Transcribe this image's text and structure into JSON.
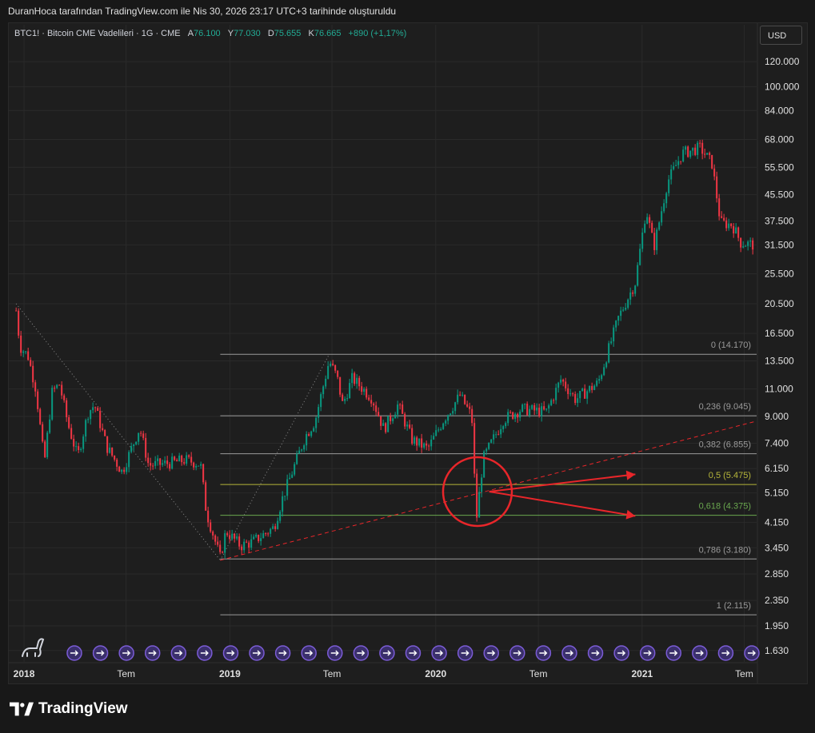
{
  "caption": "DuranHoca tarafından TradingView.com ile Nis 30, 2026 23:17 UTC+3 tarihinde oluşturuldu",
  "legend": {
    "symbol": "BTC1! · Bitcoin CME Vadelileri · 1G · CME",
    "open_label": "A",
    "open": "76.100",
    "high_label": "Y",
    "high": "77.030",
    "low_label": "D",
    "low": "75.655",
    "close_label": "K",
    "close": "76.665",
    "change": "+890 (+1,17%)"
  },
  "currency_button": "USD",
  "brand": "TradingView",
  "colors": {
    "up": "#089981",
    "down": "#f23645",
    "accent_red": "#e8262a",
    "fib_line": "#9a9a9a",
    "fib_05": "#b5b53a",
    "fib_0618": "#6aa84f",
    "grid": "#2a2a2a",
    "event_marker": "#7b5cd6"
  },
  "icons": [
    "dino-icon",
    "tradingview-logo-icon",
    "event-marker-icon"
  ],
  "chart_data": {
    "type": "candlestick",
    "title": "",
    "y_scale": "log",
    "ylim": [
      1500,
      135000
    ],
    "y_ticks": [
      {
        "value": 120000,
        "label": "120.000"
      },
      {
        "value": 100000,
        "label": "100.000"
      },
      {
        "value": 84000,
        "label": "84.000"
      },
      {
        "value": 68000,
        "label": "68.000"
      },
      {
        "value": 55500,
        "label": "55.500"
      },
      {
        "value": 45500,
        "label": "45.500"
      },
      {
        "value": 37500,
        "label": "37.500"
      },
      {
        "value": 31500,
        "label": "31.500"
      },
      {
        "value": 25500,
        "label": "25.500"
      },
      {
        "value": 20500,
        "label": "20.500"
      },
      {
        "value": 16500,
        "label": "16.500"
      },
      {
        "value": 13500,
        "label": "13.500"
      },
      {
        "value": 11000,
        "label": "11.000"
      },
      {
        "value": 9000,
        "label": "9.000"
      },
      {
        "value": 7400,
        "label": "7.400"
      },
      {
        "value": 6150,
        "label": "6.150"
      },
      {
        "value": 5150,
        "label": "5.150"
      },
      {
        "value": 4150,
        "label": "4.150"
      },
      {
        "value": 3450,
        "label": "3.450"
      },
      {
        "value": 2850,
        "label": "2.850"
      },
      {
        "value": 2350,
        "label": "2.350"
      },
      {
        "value": 1950,
        "label": "1.950"
      },
      {
        "value": 1630,
        "label": "1.630"
      }
    ],
    "x_ticks": [
      {
        "date": "2018-01-01",
        "label": "2018",
        "bold": true
      },
      {
        "date": "2018-07-01",
        "label": "Tem",
        "bold": false
      },
      {
        "date": "2019-01-01",
        "label": "2019",
        "bold": true
      },
      {
        "date": "2019-07-01",
        "label": "Tem",
        "bold": false
      },
      {
        "date": "2020-01-01",
        "label": "2020",
        "bold": true
      },
      {
        "date": "2020-07-01",
        "label": "Tem",
        "bold": false
      },
      {
        "date": "2021-01-01",
        "label": "2021",
        "bold": true
      },
      {
        "date": "2021-07-01",
        "label": "Tem",
        "bold": false
      }
    ],
    "xlim": [
      "2017-12-05",
      "2021-07-23"
    ],
    "price_path": [
      {
        "date": "2017-12-18",
        "price": 19500
      },
      {
        "date": "2017-12-25",
        "price": 15000
      },
      {
        "date": "2018-01-08",
        "price": 14000
      },
      {
        "date": "2018-01-22",
        "price": 11000
      },
      {
        "date": "2018-02-06",
        "price": 6400
      },
      {
        "date": "2018-02-20",
        "price": 10800
      },
      {
        "date": "2018-03-05",
        "price": 11400
      },
      {
        "date": "2018-03-20",
        "price": 8500
      },
      {
        "date": "2018-04-06",
        "price": 6700
      },
      {
        "date": "2018-04-25",
        "price": 9300
      },
      {
        "date": "2018-05-06",
        "price": 9800
      },
      {
        "date": "2018-05-28",
        "price": 7200
      },
      {
        "date": "2018-06-24",
        "price": 6000
      },
      {
        "date": "2018-07-25",
        "price": 8300
      },
      {
        "date": "2018-08-10",
        "price": 6300
      },
      {
        "date": "2018-09-15",
        "price": 6400
      },
      {
        "date": "2018-10-15",
        "price": 6550
      },
      {
        "date": "2018-11-10",
        "price": 6350
      },
      {
        "date": "2018-11-20",
        "price": 4500
      },
      {
        "date": "2018-12-15",
        "price": 3200
      },
      {
        "date": "2018-12-25",
        "price": 3900
      },
      {
        "date": "2019-01-20",
        "price": 3500
      },
      {
        "date": "2019-02-10",
        "price": 3600
      },
      {
        "date": "2019-03-20",
        "price": 4000
      },
      {
        "date": "2019-04-05",
        "price": 5000
      },
      {
        "date": "2019-05-15",
        "price": 7800
      },
      {
        "date": "2019-06-01",
        "price": 8700
      },
      {
        "date": "2019-06-26",
        "price": 13500
      },
      {
        "date": "2019-07-10",
        "price": 12000
      },
      {
        "date": "2019-07-20",
        "price": 9800
      },
      {
        "date": "2019-08-06",
        "price": 11900
      },
      {
        "date": "2019-09-10",
        "price": 10300
      },
      {
        "date": "2019-10-01",
        "price": 8200
      },
      {
        "date": "2019-10-26",
        "price": 9800
      },
      {
        "date": "2019-11-20",
        "price": 7600
      },
      {
        "date": "2019-12-18",
        "price": 7100
      },
      {
        "date": "2020-01-15",
        "price": 8800
      },
      {
        "date": "2020-02-13",
        "price": 10500
      },
      {
        "date": "2020-03-05",
        "price": 9000
      },
      {
        "date": "2020-03-13",
        "price": 4200
      },
      {
        "date": "2020-03-25",
        "price": 6600
      },
      {
        "date": "2020-04-30",
        "price": 8800
      },
      {
        "date": "2020-06-01",
        "price": 9500
      },
      {
        "date": "2020-07-15",
        "price": 9300
      },
      {
        "date": "2020-08-10",
        "price": 11800
      },
      {
        "date": "2020-09-05",
        "price": 10200
      },
      {
        "date": "2020-10-15",
        "price": 11500
      },
      {
        "date": "2020-11-20",
        "price": 18500
      },
      {
        "date": "2020-12-20",
        "price": 24000
      },
      {
        "date": "2021-01-08",
        "price": 41000
      },
      {
        "date": "2021-01-22",
        "price": 31000
      },
      {
        "date": "2021-02-15",
        "price": 50000
      },
      {
        "date": "2021-03-13",
        "price": 61500
      },
      {
        "date": "2021-04-14",
        "price": 64000
      },
      {
        "date": "2021-05-05",
        "price": 57000
      },
      {
        "date": "2021-05-20",
        "price": 37000
      },
      {
        "date": "2021-06-10",
        "price": 36500
      },
      {
        "date": "2021-06-25",
        "price": 32000
      },
      {
        "date": "2021-07-20",
        "price": 31500
      }
    ],
    "fibonacci": {
      "start_date": "2018-12-15",
      "end_date": "2021-07-23",
      "levels": [
        {
          "ratio": "0",
          "value": 14170,
          "label": "0 (14.170)",
          "color": "#9a9a9a"
        },
        {
          "ratio": "0,236",
          "value": 9045,
          "label": "0,236 (9.045)",
          "color": "#9a9a9a"
        },
        {
          "ratio": "0,382",
          "value": 6855,
          "label": "0,382 (6.855)",
          "color": "#9a9a9a"
        },
        {
          "ratio": "0,5",
          "value": 5475,
          "label": "0,5 (5.475)",
          "color": "#b5b53a"
        },
        {
          "ratio": "0,618",
          "value": 4375,
          "label": "0,618 (4.375)",
          "color": "#6aa84f"
        },
        {
          "ratio": "0,786",
          "value": 3180,
          "label": "0,786 (3.180)",
          "color": "#9a9a9a"
        },
        {
          "ratio": "1",
          "value": 2115,
          "label": "1 (2.115)",
          "color": "#9a9a9a"
        }
      ]
    },
    "trendlines": [
      {
        "style": "dotted",
        "from": {
          "date": "2017-12-18",
          "price": 20500
        },
        "to": {
          "date": "2018-12-15",
          "price": 3150
        }
      },
      {
        "style": "dotted",
        "from": {
          "date": "2018-12-15",
          "price": 3150
        },
        "to": {
          "date": "2019-06-26",
          "price": 14170
        }
      },
      {
        "style": "dashed-red",
        "from": {
          "date": "2018-12-15",
          "price": 3150
        },
        "to": {
          "date": "2021-07-23",
          "price": 8700
        }
      }
    ],
    "highlight_circle": {
      "date": "2020-03-15",
      "price": 5200
    },
    "arrows": [
      {
        "from": {
          "date": "2020-04-05",
          "price": 5200
        },
        "to": {
          "date": "2020-12-20",
          "price": 5900
        }
      },
      {
        "from": {
          "date": "2020-04-05",
          "price": 5200
        },
        "to": {
          "date": "2020-12-20",
          "price": 4350
        }
      }
    ],
    "event_marker_count": 27
  }
}
